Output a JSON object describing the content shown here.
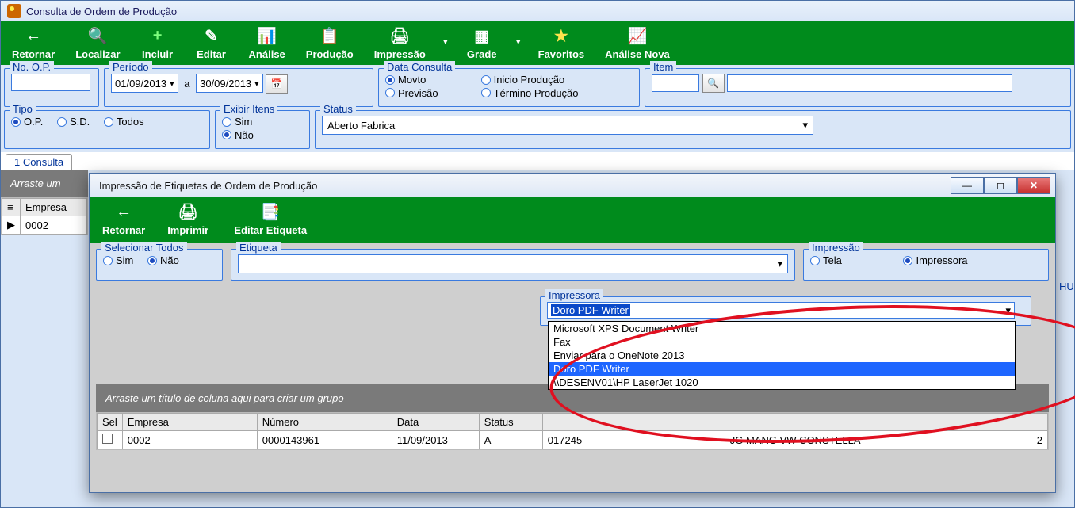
{
  "main": {
    "title": "Consulta de Ordem de Produção",
    "toolbar": {
      "retornar": "Retornar",
      "localizar": "Localizar",
      "incluir": "Incluir",
      "editar": "Editar",
      "analise": "Análise",
      "producao": "Produção",
      "impressao": "Impressão",
      "grade": "Grade",
      "favoritos": "Favoritos",
      "analise_nova": "Análise Nova"
    },
    "filters": {
      "no_op_label": "No. O.P.",
      "no_op_value": "",
      "periodo_label": "Período",
      "periodo_de": "01/09/2013",
      "periodo_a_label": "a",
      "periodo_ate": "30/09/2013",
      "data_consulta_label": "Data Consulta",
      "dc_movto": "Movto",
      "dc_previsao": "Previsão",
      "dc_inicio": "Inicio Produção",
      "dc_termino": "Término Produção",
      "item_label": "Item",
      "item_value": "",
      "tipo_label": "Tipo",
      "tipo_op": "O.P.",
      "tipo_sd": "S.D.",
      "tipo_todos": "Todos",
      "exibir_label": "Exibir Itens",
      "exibir_sim": "Sim",
      "exibir_nao": "Não",
      "status_label": "Status",
      "status_value": "Aberto Fabrica"
    },
    "tab": {
      "consulta": "1 Consulta"
    },
    "groupbar_hint": "Arraste um",
    "grid": {
      "headers": {
        "empresa": "Empresa"
      },
      "row0": {
        "empresa": "0002"
      }
    }
  },
  "dialog": {
    "title": "Impressão de Etiquetas de Ordem de Produção",
    "toolbar": {
      "retornar": "Retornar",
      "imprimir": "Imprimir",
      "editar_etiqueta": "Editar Etiqueta"
    },
    "selecionar_label": "Selecionar Todos",
    "sel_sim": "Sim",
    "sel_nao": "Não",
    "etiqueta_label": "Etiqueta",
    "etiqueta_value": "",
    "impressao_group_label": "Impressão",
    "imp_tela": "Tela",
    "imp_impressora": "Impressora",
    "impressora_group_label": "Impressora",
    "impressora_selected": "Doro PDF Writer",
    "impressora_options": {
      "o0": "Microsoft XPS Document Writer",
      "o1": "Fax",
      "o2": "Enviar para o OneNote 2013",
      "o3": "Doro PDF Writer",
      "o4": "\\\\DESENV01\\HP LaserJet 1020"
    },
    "groupbar_hint": "Arraste um título de coluna aqui para criar um grupo",
    "grid": {
      "headers": {
        "sel": "Sel",
        "empresa": "Empresa",
        "numero": "Número",
        "data": "Data",
        "status": "Status",
        "col6": "",
        "col7": "",
        "col8": ""
      },
      "row0": {
        "empresa": "0002",
        "numero": "0000143961",
        "data": "11/09/2013",
        "status": "A",
        "c6": "017245",
        "c7": "JG MANG VW CONSTELLA",
        "c8": "2"
      }
    },
    "right_edge_hint": "HU"
  }
}
